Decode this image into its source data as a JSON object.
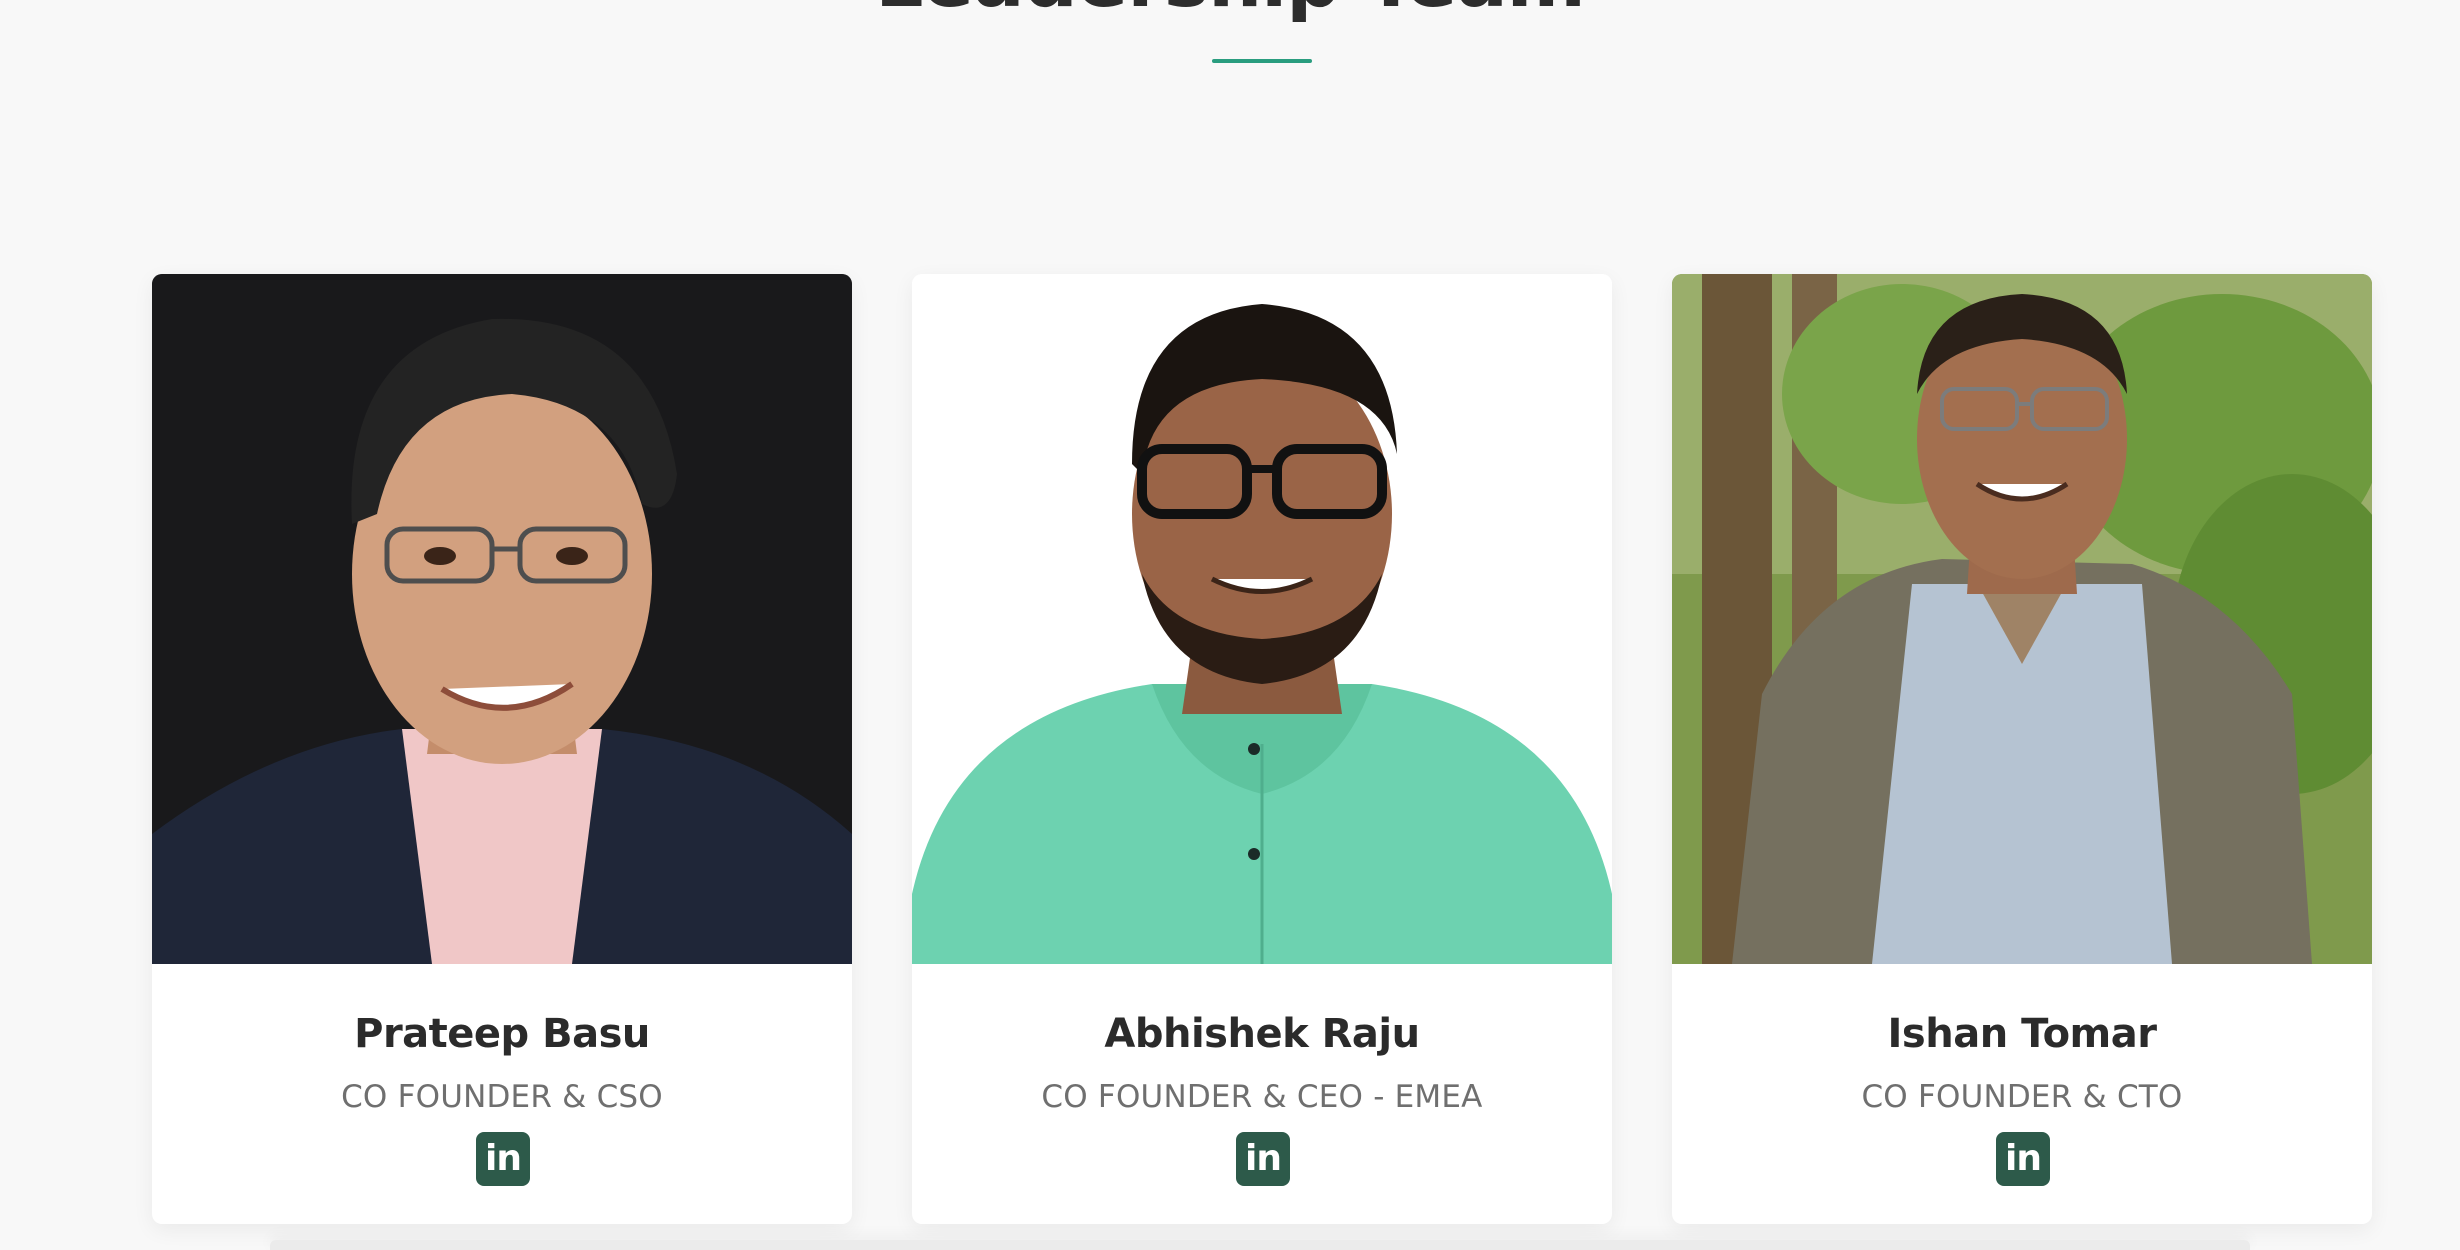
{
  "section": {
    "title": "Leadership Team",
    "accent_color": "#2a9d7f"
  },
  "team": [
    {
      "name": "Prateep Basu",
      "role": "CO FOUNDER & CSO",
      "social": "linkedin-icon",
      "social_label": "in"
    },
    {
      "name": "Abhishek Raju",
      "role": "CO FOUNDER & CEO - EMEA",
      "social": "linkedin-icon",
      "social_label": "in"
    },
    {
      "name": "Ishan Tomar",
      "role": "CO FOUNDER & CTO",
      "social": "linkedin-icon",
      "social_label": "in"
    }
  ],
  "colors": {
    "background": "#f8f8f8",
    "card": "#ffffff",
    "name_text": "#2b2b2b",
    "role_text": "#6f6f6f",
    "social_badge": "#2d5a4a"
  }
}
